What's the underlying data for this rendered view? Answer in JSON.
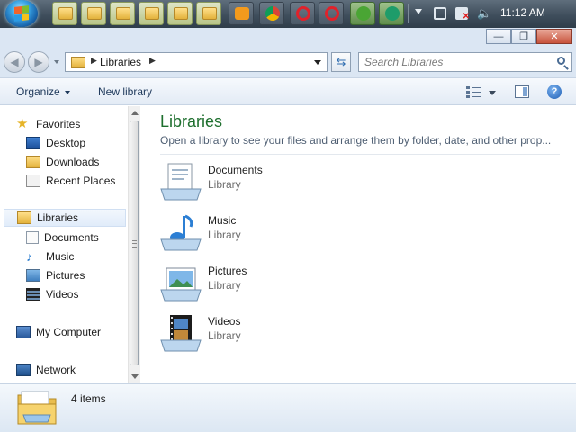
{
  "taskbar": {
    "clock": "11:12 AM"
  },
  "window": {
    "controls": {
      "minimize": "—",
      "maximize": "❐",
      "close": "✕"
    }
  },
  "address": {
    "location": "Libraries",
    "search_placeholder": "Search Libraries"
  },
  "command_bar": {
    "organize": "Organize",
    "new_library": "New library"
  },
  "nav": {
    "favorites": {
      "label": "Favorites",
      "items": [
        "Desktop",
        "Downloads",
        "Recent Places"
      ]
    },
    "libraries": {
      "label": "Libraries",
      "items": [
        "Documents",
        "Music",
        "Pictures",
        "Videos"
      ]
    },
    "computer": "My Computer",
    "network": "Network"
  },
  "content": {
    "title": "Libraries",
    "subtitle": "Open a library to see your files and arrange them by folder, date, and other prop...",
    "libraries": [
      {
        "name": "Documents",
        "kind": "Library"
      },
      {
        "name": "Music",
        "kind": "Library"
      },
      {
        "name": "Pictures",
        "kind": "Library"
      },
      {
        "name": "Videos",
        "kind": "Library"
      }
    ]
  },
  "details": {
    "item_count": "4 items"
  },
  "colors": {
    "title_green": "#1e6f2e",
    "taskbar": "#3f4e5c",
    "selection": "#e1ecfa"
  }
}
